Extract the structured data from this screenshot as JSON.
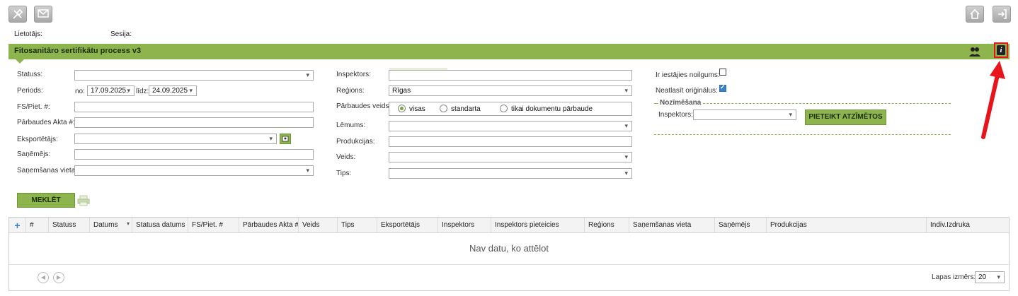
{
  "toolbar": {
    "tools_icon": "tools-icon",
    "mail_icon": "mail-icon",
    "home_icon": "home-icon",
    "exit_icon": "exit-icon"
  },
  "info": {
    "user_label": "Lietotājs:",
    "session_label": "Sesija:"
  },
  "title": "Fitosanitāro sertifikātu process v3",
  "title_icons": {
    "users": "users-icon",
    "info": "info-icon"
  },
  "left_form": {
    "status_label": "Statuss:",
    "period_label": "Periods:",
    "period_from_label": "no:",
    "period_from_value": "17.09.2025.",
    "period_to_label": "līdz:",
    "period_to_value": "24.09.2025",
    "fs_label": "FS/Piet. #:",
    "act_label": "Pārbaudes Akta #:",
    "exporter_label": "Eksportētājs:",
    "receiver_label": "Saņēmējs:",
    "receive_place_label": "Saņemšanas vieta:"
  },
  "mid_form": {
    "inspector_label": "Inspektors:",
    "region_label": "Reģions:",
    "region_value": "Rīgas",
    "check_type_label": "Pārbaudes veids:",
    "check_options": [
      "visas",
      "standarta",
      "tikai dokumentu pārbaude"
    ],
    "decision_label": "Lēmums:",
    "products_label": "Produkcijas:",
    "type_label": "Veids:",
    "tips_label": "Tips:"
  },
  "right_form": {
    "overdue_label": "Ir iestājies noilgums:",
    "no_original_label": "Neatlasīt oriģinālus:",
    "assign_title": "Nozīmēšana",
    "assign_inspector_label": "Inspektors:",
    "assign_button": "PIETEIKT ATZĪMĒTOS"
  },
  "search_button": "MEKLĒT",
  "grid": {
    "columns": [
      "#",
      "Statuss",
      "Datums",
      "Statusa datums",
      "FS/Piet. #",
      "Pārbaudes Akta #",
      "Veids",
      "Tips",
      "Eksportētājs",
      "Inspektors",
      "Inspektors pieteicies",
      "Reģions",
      "Saņemšanas vieta",
      "Saņēmējs",
      "Produkcijas",
      "Indiv.Izdruka"
    ],
    "empty_text": "Nav datu, ko attēlot",
    "page_size_label": "Lapas izmērs:",
    "page_size_value": "20"
  },
  "colors": {
    "accent": "#8db44d",
    "annotation": "#e8141b"
  }
}
